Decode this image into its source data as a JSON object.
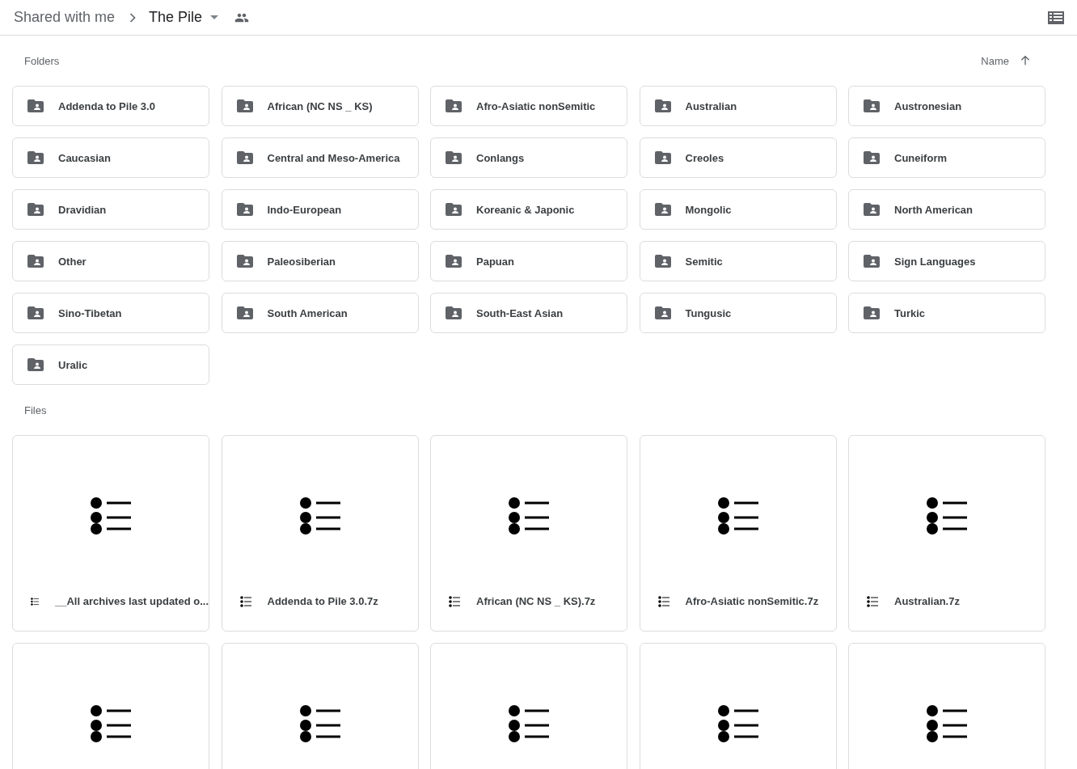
{
  "breadcrumb": [
    {
      "label": "Shared with me",
      "current": false
    },
    {
      "label": "The Pile",
      "current": true
    }
  ],
  "folders": {
    "heading": "Folders",
    "sort": {
      "label": "Name"
    },
    "items": [
      {
        "name": "Addenda to Pile 3.0"
      },
      {
        "name": "African (NC NS _ KS)"
      },
      {
        "name": "Afro-Asiatic nonSemitic"
      },
      {
        "name": "Australian"
      },
      {
        "name": "Austronesian"
      },
      {
        "name": "Caucasian"
      },
      {
        "name": "Central and Meso-America"
      },
      {
        "name": "Conlangs"
      },
      {
        "name": "Creoles"
      },
      {
        "name": "Cuneiform"
      },
      {
        "name": "Dravidian"
      },
      {
        "name": "Indo-European"
      },
      {
        "name": "Koreanic & Japonic"
      },
      {
        "name": "Mongolic"
      },
      {
        "name": "North American"
      },
      {
        "name": "Other"
      },
      {
        "name": "Paleosiberian"
      },
      {
        "name": "Papuan"
      },
      {
        "name": "Semitic"
      },
      {
        "name": "Sign Languages"
      },
      {
        "name": "Sino-Tibetan"
      },
      {
        "name": "South American"
      },
      {
        "name": "South-East Asian"
      },
      {
        "name": "Tungusic"
      },
      {
        "name": "Turkic"
      },
      {
        "name": "Uralic"
      }
    ]
  },
  "files": {
    "heading": "Files",
    "items": [
      {
        "kind": "list",
        "name": "__All archives last updated o..."
      },
      {
        "kind": "list",
        "name": "Addenda to Pile 3.0.7z"
      },
      {
        "kind": "list",
        "name": "African (NC NS _ KS).7z"
      },
      {
        "kind": "list",
        "name": "Afro-Asiatic nonSemitic.7z"
      },
      {
        "kind": "list",
        "name": "Australian.7z"
      },
      {
        "kind": "list"
      },
      {
        "kind": "list"
      },
      {
        "kind": "list"
      },
      {
        "kind": "list"
      },
      {
        "kind": "list"
      }
    ]
  }
}
